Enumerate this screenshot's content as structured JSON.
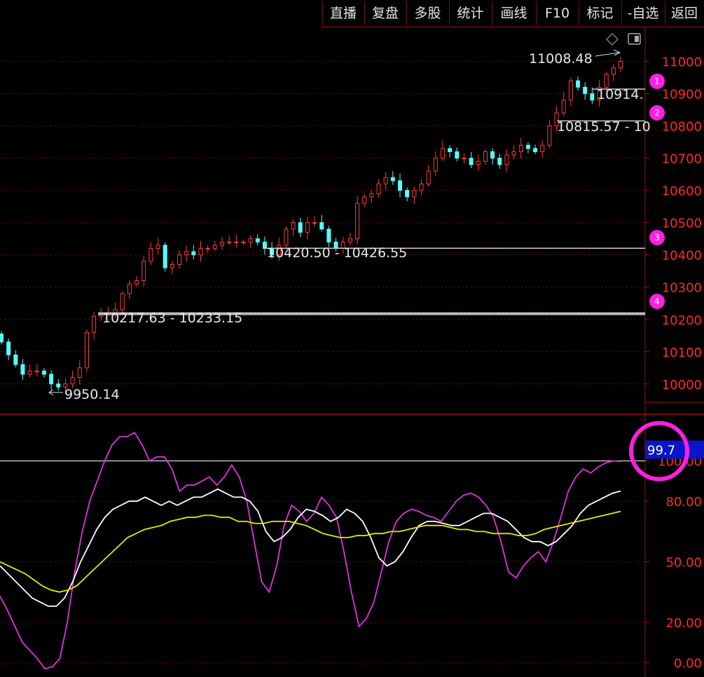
{
  "toolbar": {
    "buttons": [
      {
        "label": "直播"
      },
      {
        "label": "复盘"
      },
      {
        "label": "多股"
      },
      {
        "label": "统计"
      },
      {
        "label": "画线"
      },
      {
        "label": "F10"
      },
      {
        "label": "标记"
      },
      {
        "label": "-自选"
      },
      {
        "label": "返回"
      }
    ]
  },
  "colors": {
    "background": "#000000",
    "up_candle": "#ff3b3b",
    "down_candle": "#54ffff",
    "axis_text": "#ff2a2a",
    "grid": "#7a0d0d",
    "k_line": "#ffffff",
    "d_line": "#e8e800",
    "j_line": "#dd33dd",
    "marker": "#ff1fe0",
    "readout_bg": "#0a14c8"
  },
  "icons": [
    "diamond-icon",
    "panel-toggle-icon"
  ],
  "chart_data": [
    {
      "type": "candlestick",
      "y_ticks": [
        "11000",
        "10900",
        "10800",
        "10700",
        "10600",
        "10500",
        "10400",
        "10300",
        "10200",
        "10100",
        "10000"
      ],
      "ylim": [
        9930,
        11060
      ],
      "grid": true,
      "high_label": "11008.48",
      "low_label": "9950.14",
      "annotations": [
        {
          "text": "10914.",
          "price": 10914
        },
        {
          "text": "10815.57 - 10",
          "price": 10815.57
        },
        {
          "text": "10420.50 - 10426.55",
          "price": 10420.5
        },
        {
          "text": "10217.63 - 10233.15",
          "price": 10217.63
        }
      ],
      "markers": [
        {
          "label": "1",
          "price": 10920
        },
        {
          "label": "2",
          "price": 10820
        },
        {
          "label": "3",
          "price": 10410
        },
        {
          "label": "4",
          "price": 10220
        }
      ],
      "closes": [
        10130,
        10090,
        10060,
        10030,
        10040,
        10040,
        10030,
        10000,
        9990,
        10000,
        10020,
        10050,
        10160,
        10210,
        10220,
        10220,
        10230,
        10280,
        10310,
        10320,
        10380,
        10420,
        10430,
        10360,
        10370,
        10400,
        10410,
        10400,
        10420,
        10420,
        10430,
        10440,
        10440,
        10440,
        10440,
        10450,
        10440,
        10420,
        10400,
        10430,
        10480,
        10500,
        10470,
        10500,
        10500,
        10480,
        10440,
        10420,
        10440,
        10450,
        10560,
        10580,
        10590,
        10620,
        10640,
        10630,
        10600,
        10580,
        10600,
        10620,
        10660,
        10700,
        10730,
        10720,
        10700,
        10700,
        10680,
        10690,
        10720,
        10700,
        10680,
        10710,
        10720,
        10740,
        10730,
        10720,
        10740,
        10800,
        10840,
        10880,
        10940,
        10920,
        10900,
        10880,
        10920,
        10960,
        10980,
        11000
      ]
    },
    {
      "type": "line",
      "y_ticks": [
        "100.00",
        "80.00",
        "50.00",
        "20.00",
        "0.00"
      ],
      "ylim": [
        -5,
        120
      ],
      "readout": "99.7",
      "series": [
        {
          "color": "#dd33dd",
          "values": [
            33,
            26,
            18,
            10,
            6,
            2,
            -3,
            -2,
            2,
            20,
            45,
            65,
            80,
            90,
            100,
            108,
            112,
            112,
            114,
            108,
            100,
            102,
            102,
            96,
            85,
            88,
            88,
            90,
            92,
            88,
            92,
            98,
            92,
            80,
            60,
            40,
            35,
            48,
            68,
            78,
            75,
            70,
            74,
            82,
            78,
            72,
            55,
            35,
            18,
            22,
            30,
            45,
            60,
            70,
            74,
            76,
            75,
            73,
            72,
            70,
            75,
            80,
            83,
            84,
            82,
            78,
            72,
            60,
            45,
            42,
            48,
            52,
            55,
            50,
            60,
            72,
            85,
            92,
            96,
            94,
            97,
            99,
            100,
            99.7
          ]
        },
        {
          "color": "#ffffff",
          "values": [
            48,
            44,
            40,
            36,
            32,
            30,
            28,
            28,
            32,
            40,
            50,
            58,
            66,
            72,
            76,
            78,
            80,
            80,
            82,
            80,
            78,
            80,
            78,
            80,
            82,
            82,
            84,
            86,
            84,
            82,
            82,
            80,
            75,
            65,
            60,
            62,
            66,
            72,
            76,
            75,
            73,
            70,
            72,
            76,
            74,
            70,
            62,
            52,
            48,
            50,
            55,
            62,
            68,
            70,
            70,
            69,
            68,
            68,
            70,
            72,
            74,
            74,
            72,
            70,
            66,
            62,
            60,
            60,
            58,
            60,
            64,
            68,
            74,
            78,
            80,
            82,
            84,
            85
          ]
        },
        {
          "color": "#e8e800",
          "values": [
            50,
            48,
            46,
            44,
            41,
            38,
            36,
            35,
            36,
            38,
            42,
            46,
            50,
            54,
            58,
            62,
            64,
            66,
            67,
            68,
            70,
            71,
            72,
            72,
            73,
            73,
            72,
            72,
            70,
            70,
            69,
            69,
            70,
            70,
            70,
            69,
            68,
            66,
            64,
            63,
            62,
            62,
            63,
            63,
            64,
            64,
            65,
            65,
            66,
            67,
            68,
            68,
            68,
            67,
            66,
            66,
            65,
            65,
            64,
            64,
            64,
            63,
            63,
            64,
            66,
            67,
            68,
            69,
            70,
            71,
            72,
            73,
            74,
            75
          ]
        }
      ]
    }
  ]
}
